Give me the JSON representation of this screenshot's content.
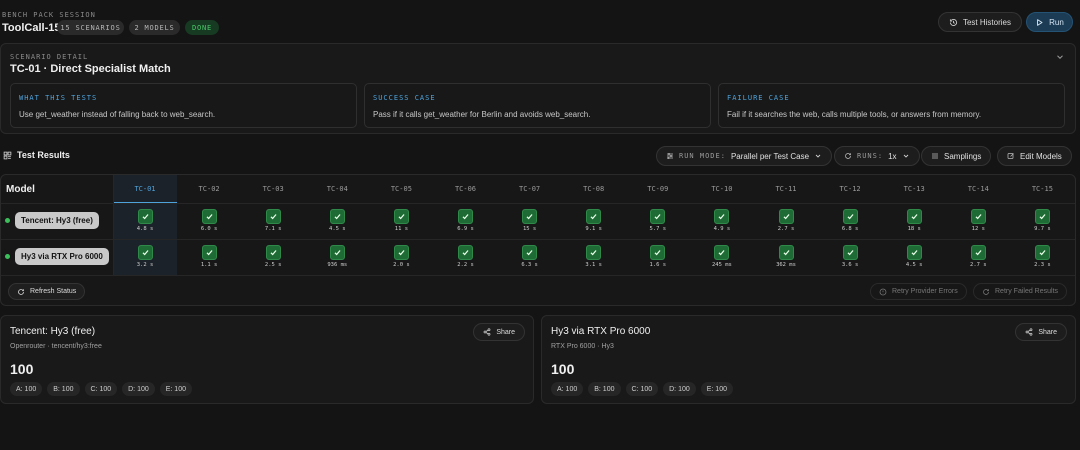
{
  "header": {
    "eyebrow": "BENCH PACK SESSION",
    "title": "ToolCall-15",
    "badges": [
      {
        "label": "15 SCENARIOS",
        "status": "neutral"
      },
      {
        "label": "2 MODELS",
        "status": "neutral"
      },
      {
        "label": "DONE",
        "status": "success",
        "color": "#4cc96a"
      }
    ],
    "history_button": {
      "label": "Test Histories",
      "icon": "history-icon"
    },
    "run_button": {
      "label": "Run",
      "icon": "play-icon",
      "color": "#1c3b54"
    }
  },
  "scenario": {
    "eyebrow": "SCENARIO DETAIL",
    "title": "TC-01 · Direct Specialist Match",
    "collapse_icon": "chevron-down-icon",
    "cases": [
      {
        "heading": "WHAT THIS TESTS",
        "body": "Use get_weather instead of falling back to web_search."
      },
      {
        "heading": "SUCCESS CASE",
        "body": "Pass if it calls get_weather for Berlin and avoids web_search."
      },
      {
        "heading": "FAILURE CASE",
        "body": "Fail if it searches the web, calls multiple tools, or answers from memory."
      }
    ]
  },
  "results": {
    "title": "Test Results",
    "run_mode": {
      "label": "RUN MODE:",
      "value": "Parallel per Test Case"
    },
    "runs": {
      "label": "RUNS:",
      "value": "1x"
    },
    "samplings_label": "Samplings",
    "edit_models_label": "Edit Models",
    "model_header": "Model",
    "active_column": "TC-01",
    "columns": [
      "TC-01",
      "TC-02",
      "TC-03",
      "TC-04",
      "TC-05",
      "TC-06",
      "TC-07",
      "TC-08",
      "TC-09",
      "TC-10",
      "TC-11",
      "TC-12",
      "TC-13",
      "TC-14",
      "TC-15"
    ],
    "rows": [
      {
        "model": "Tencent: Hy3 (free)",
        "status": "online",
        "times": [
          "4.8 s",
          "6.0 s",
          "7.1 s",
          "4.5 s",
          "11 s",
          "6.9 s",
          "15 s",
          "9.1 s",
          "5.7 s",
          "4.9 s",
          "2.7 s",
          "6.8 s",
          "18 s",
          "12 s",
          "9.7 s"
        ]
      },
      {
        "model": "Hy3 via RTX Pro 6000",
        "status": "online",
        "times": [
          "3.2 s",
          "1.1 s",
          "2.5 s",
          "936 ms",
          "2.0 s",
          "2.2 s",
          "6.3 s",
          "3.1 s",
          "1.6 s",
          "245 ms",
          "362 ms",
          "3.6 s",
          "4.5 s",
          "2.7 s",
          "2.3 s"
        ]
      }
    ],
    "cell_result": "pass",
    "pass_color": "#1f6b36",
    "refresh_label": "Refresh Status",
    "retry_provider_label": "Retry Provider Errors",
    "retry_failed_label": "Retry Failed Results"
  },
  "cards": [
    {
      "title": "Tencent: Hy3 (free)",
      "subtitle": "Openrouter · tencent/hy3:free",
      "score": "100",
      "share_label": "Share",
      "grades": [
        "A: 100",
        "B: 100",
        "C: 100",
        "D: 100",
        "E: 100"
      ]
    },
    {
      "title": "Hy3 via RTX Pro 6000",
      "subtitle": "RTX Pro 6000 · Hy3",
      "score": "100",
      "share_label": "Share",
      "grades": [
        "A: 100",
        "B: 100",
        "C: 100",
        "D: 100",
        "E: 100"
      ]
    }
  ]
}
